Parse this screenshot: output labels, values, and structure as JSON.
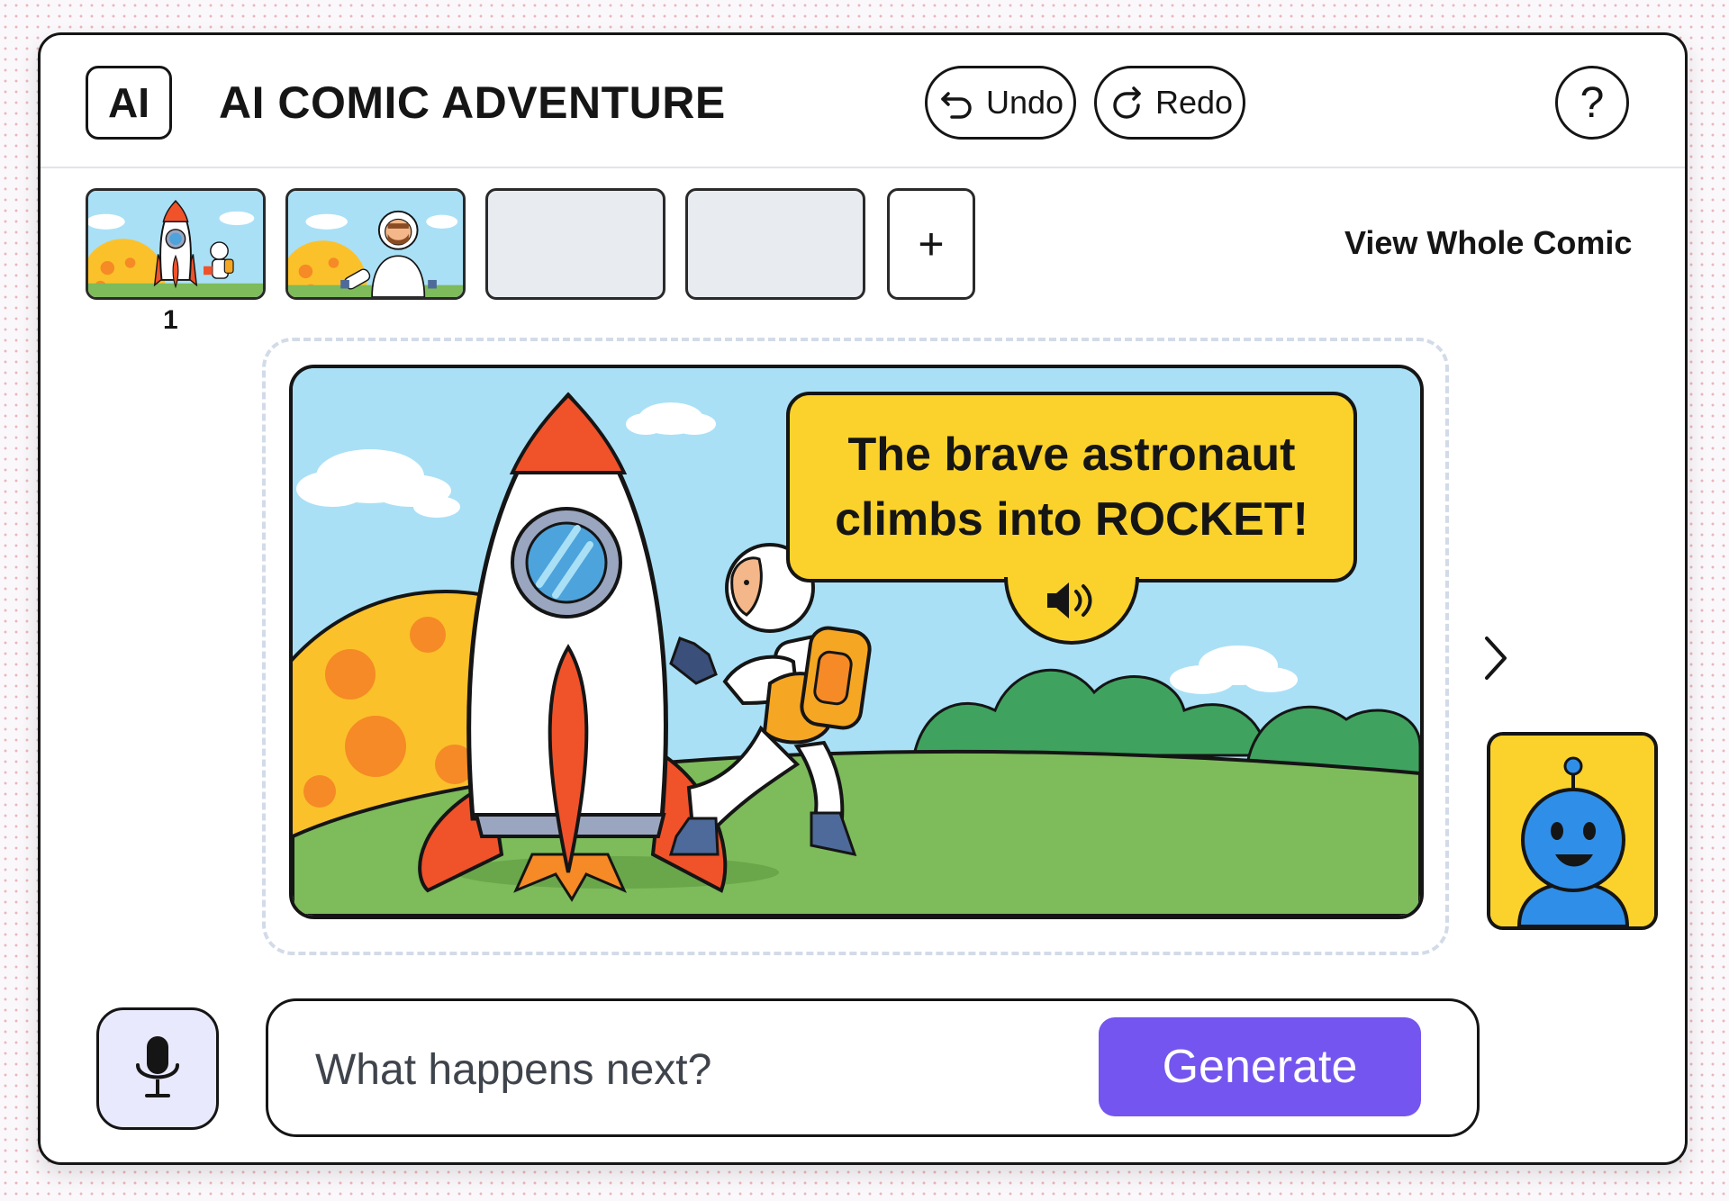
{
  "app": {
    "logo_text": "AI",
    "title": "AI COMIC ADVENTURE"
  },
  "toolbar": {
    "undo_label": "Undo",
    "redo_label": "Redo",
    "help_label": "?"
  },
  "filmstrip": {
    "frames": [
      {
        "label": "1",
        "state": "filled"
      },
      {
        "label": "",
        "state": "filled"
      },
      {
        "label": "",
        "state": "empty"
      },
      {
        "label": "",
        "state": "empty"
      }
    ],
    "add_label": "+",
    "view_whole_label": "View Whole Comic"
  },
  "panel": {
    "caption_line1": "The brave astronaut",
    "caption_line2": "climbs into ROCKET!",
    "speaker_icon": "speaker-icon"
  },
  "assistant": {
    "icon": "robot-avatar-icon"
  },
  "composer": {
    "placeholder": "What happens next?",
    "value": "",
    "generate_label": "Generate",
    "mic_icon": "microphone-icon"
  },
  "colors": {
    "accent": "#7455ef",
    "bubble_yellow": "#fbd22b",
    "sky": "#a9e0f6",
    "grass": "#7dbb5b",
    "rocket_red": "#f0522a",
    "robot_blue": "#2f8fe8",
    "mic_bg": "#e9e9fd"
  }
}
